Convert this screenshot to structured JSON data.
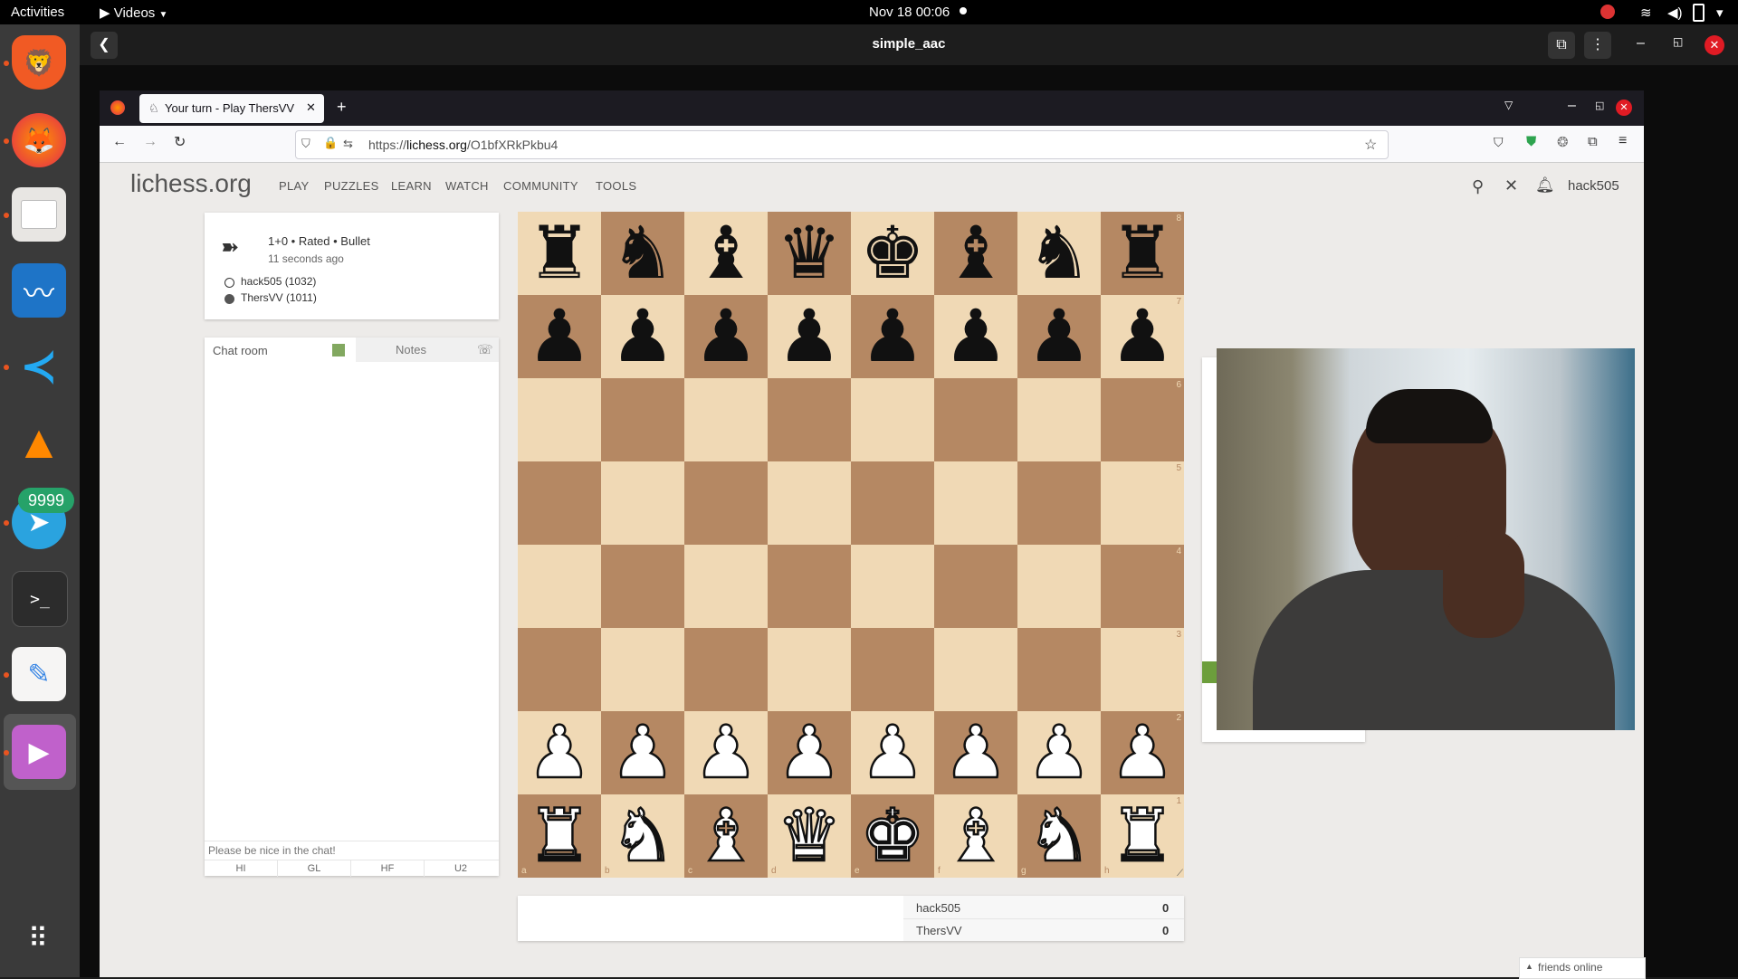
{
  "topbar": {
    "activities": "Activities",
    "app_menu": "Videos",
    "clock": "Nov 18  00:06"
  },
  "dock": {
    "telegram_badge": "9999"
  },
  "window": {
    "title": "simple_aac"
  },
  "browser": {
    "tab_title": "Your turn - Play ThersVV",
    "url_prefix": "https://",
    "url_domain": "lichess.org",
    "url_path": "/O1bfXRkPkbu4"
  },
  "lichess": {
    "logo": "lichess.org",
    "nav": [
      "PLAY",
      "PUZZLES",
      "LEARN",
      "WATCH",
      "COMMUNITY",
      "TOOLS"
    ],
    "username": "hack505",
    "game": {
      "summary": "1+0 • Rated • Bullet",
      "time_ago": "11 seconds ago",
      "white_player": "hack505 (1032)",
      "black_player": "ThersVV (1011)"
    },
    "chat": {
      "tab_chat": "Chat room",
      "tab_notes": "Notes",
      "placeholder": "Please be nice in the chat!",
      "presets": [
        "HI",
        "GL",
        "HF",
        "U2"
      ]
    },
    "board": {
      "ranks": [
        "8",
        "7",
        "6",
        "5",
        "4",
        "3",
        "2",
        "1"
      ],
      "files": [
        "a",
        "b",
        "c",
        "d",
        "e",
        "f",
        "g",
        "h"
      ],
      "position": [
        [
          "r",
          "n",
          "b",
          "q",
          "k",
          "b",
          "n",
          "r"
        ],
        [
          "p",
          "p",
          "p",
          "p",
          "p",
          "p",
          "p",
          "p"
        ],
        [
          "",
          "",
          "",
          "",
          "",
          "",
          "",
          ""
        ],
        [
          "",
          "",
          "",
          "",
          "",
          "",
          "",
          ""
        ],
        [
          "",
          "",
          "",
          "",
          "",
          "",
          "",
          ""
        ],
        [
          "",
          "",
          "",
          "",
          "",
          "",
          "",
          ""
        ],
        [
          "P",
          "P",
          "P",
          "P",
          "P",
          "P",
          "P",
          "P"
        ],
        [
          "R",
          "N",
          "B",
          "Q",
          "K",
          "B",
          "N",
          "R"
        ]
      ]
    },
    "scores": [
      {
        "name": "hack505",
        "score": "0"
      },
      {
        "name": "ThersVV",
        "score": "0"
      }
    ],
    "friends": "friends online"
  }
}
